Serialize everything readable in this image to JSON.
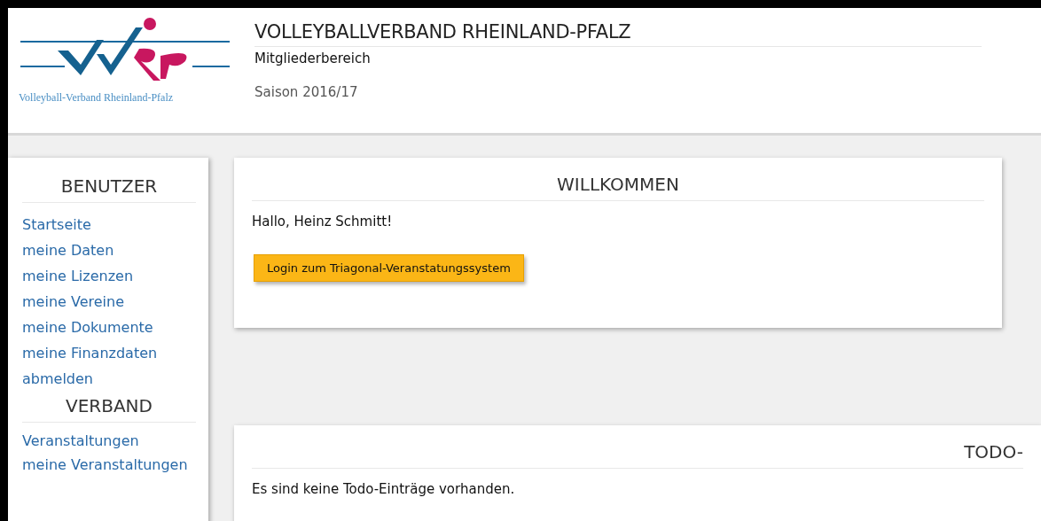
{
  "header": {
    "logo_caption": "Volleyball-Verband Rheinland-Pfalz",
    "title": "VOLLEYBALLVERBAND RHEINLAND-PFALZ",
    "subtitle": "Mitgliederbereich",
    "season": "Saison 2016/17"
  },
  "sidebar": {
    "sections": [
      {
        "title": "BENUTZER",
        "items": [
          "Startseite",
          "meine Daten",
          "meine Lizenzen",
          "meine Vereine",
          "meine Dokumente",
          "meine Finanzdaten",
          "abmelden"
        ]
      },
      {
        "title": "VERBAND",
        "items": [
          "Veranstaltungen",
          "meine Veranstaltungen"
        ]
      }
    ]
  },
  "welcome": {
    "title": "WILLKOMMEN",
    "greeting": "Hallo, Heinz Schmitt!",
    "button": "Login zum Triagonal-Veranstatungssystem"
  },
  "todo": {
    "title": "TODO-",
    "message": "Es sind keine Todo-Einträge vorhanden."
  }
}
